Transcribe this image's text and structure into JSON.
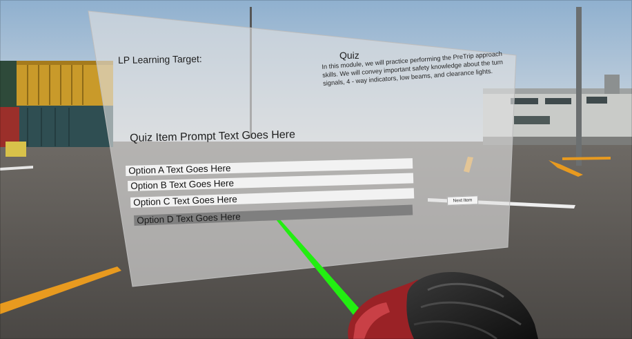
{
  "learning_target_label": "LP Learning Target:",
  "quiz": {
    "title": "Quiz",
    "description": "In this module, we will practice performing the PreTrip approach skills. We will convey important safety knowledge about the turn signals, 4 - way indicators, low beams, and clearance lights.",
    "prompt": "Quiz Item Prompt Text Goes Here",
    "options": [
      "Option A Text Goes Here",
      "Option B Text Goes Here",
      "Option C Text Goes Here",
      "Option D Text Goes Here"
    ],
    "highlighted_option_index": 3,
    "next_button_label": "Next Item"
  },
  "colors": {
    "sky": "#b9c8d8",
    "ground": "#5d5b58",
    "panel": "#d9d9d9",
    "option_bg": "#f2f2f2",
    "option_highlight": "#7f7f7f",
    "laser": "#22ee11",
    "road_marking": "#e89a1f"
  },
  "icons": {
    "controller": "vr-controller-glove-icon",
    "pointer": "laser-pointer-icon"
  }
}
